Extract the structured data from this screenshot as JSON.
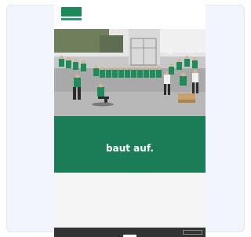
{
  "site": {
    "logo_text": "",
    "menu": [
      "",
      "",
      "",
      "",
      "",
      ""
    ]
  },
  "hero": {
    "tagline": "",
    "title": "baut auf."
  },
  "footer": {
    "note": ""
  },
  "cookie": {
    "text": "",
    "accept": "",
    "more": ""
  },
  "colors": {
    "brand_green": "#1a7d57",
    "cookie_bar": "#333333"
  }
}
